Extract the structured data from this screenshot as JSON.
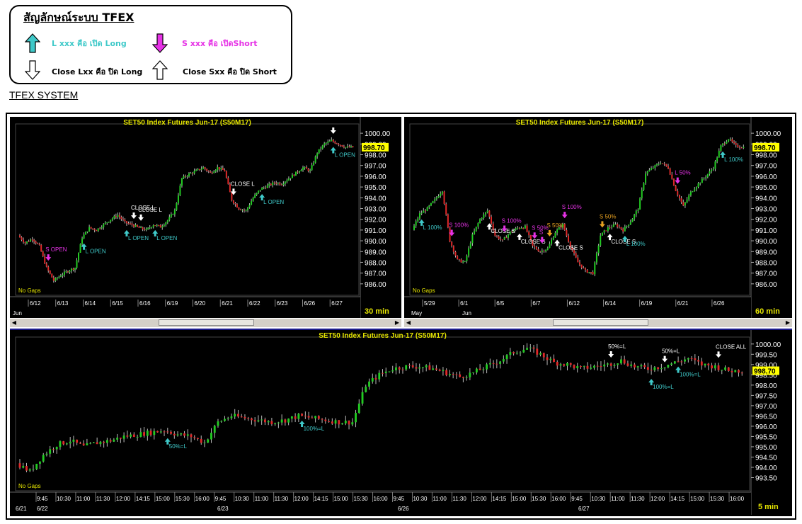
{
  "legend": {
    "title": "สัญลักษณ์ระบบ TFEX",
    "long_open": "L xxx คือ เปิด Long",
    "short_open": "S xxx คือ เปิดShort",
    "close_long": "Close Lxx คือ ปิด Long",
    "close_short": "Close Sxx คือ ปิด Short",
    "colors": {
      "long": "#3fc9c9",
      "short": "#e632e6"
    }
  },
  "system_label": "TFEX SYSTEM",
  "chart_data": [
    {
      "type": "candlestick",
      "title": "SET50  Index  Futures  Jun-17  (S50M17)",
      "timeframe": "30  min",
      "last_price": "998.70",
      "note": "No Gaps",
      "ylim": [
        985.2,
        1000.6
      ],
      "ticks": [
        "1000.00",
        "999.00",
        "998.00",
        "997.00",
        "996.00",
        "995.00",
        "994.00",
        "993.00",
        "992.00",
        "991.00",
        "990.00",
        "989.00",
        "988.00",
        "987.00",
        "986.00"
      ],
      "date_labels": [
        "6/12",
        "6/13",
        "6/14",
        "6/15",
        "6/16",
        "6/19",
        "6/20",
        "6/21",
        "6/22",
        "6/23",
        "6/26",
        "6/27"
      ],
      "bottom_label": "Jun",
      "path": [
        990.5,
        989.8,
        990.2,
        989.5,
        987.5,
        986.3,
        986.8,
        987.2,
        987.5,
        990.3,
        991.2,
        991.0,
        991.5,
        992.0,
        992.4,
        991.7,
        991.5,
        991.2,
        991.0,
        991.5,
        991.3,
        991.9,
        992.8,
        995.8,
        996.2,
        996.5,
        996.8,
        996.3,
        996.8,
        996.5,
        993.8,
        993.0,
        992.8,
        994.0,
        994.8,
        995.1,
        995.4,
        995.3,
        995.8,
        996.3,
        996.8,
        996.5,
        998.2,
        999.0,
        999.3,
        999.0,
        998.7,
        998.7
      ],
      "signals": [
        {
          "text": "S  OPEN",
          "kind": "short",
          "i": 4
        },
        {
          "text": "L  OPEN",
          "kind": "long",
          "i": 9
        },
        {
          "text": "L  OPEN",
          "kind": "long",
          "i": 15
        },
        {
          "text": "CLOSE  L",
          "kind": "closeL",
          "i": 16
        },
        {
          "text": "CLOSE  L",
          "kind": "closeL",
          "i": 17
        },
        {
          "text": "L  OPEN",
          "kind": "long",
          "i": 19
        },
        {
          "text": "CLOSE  L",
          "kind": "closeL",
          "i": 30
        },
        {
          "text": "L  OPEN",
          "kind": "long",
          "i": 34
        },
        {
          "text": "L  OPEN",
          "kind": "long",
          "i": 44
        },
        {
          "text": "",
          "kind": "closeL",
          "i": 44
        }
      ]
    },
    {
      "type": "candlestick",
      "title": "SET50  Index  Futures  Jun-17  (S50M17)",
      "timeframe": "60  min",
      "last_price": "998.70",
      "note": "No Gaps",
      "ylim": [
        985.2,
        1000.6
      ],
      "ticks": [
        "1000.00",
        "999.00",
        "998.00",
        "997.00",
        "996.00",
        "995.00",
        "994.00",
        "993.00",
        "992.00",
        "991.00",
        "990.00",
        "989.00",
        "988.00",
        "987.00",
        "986.00"
      ],
      "date_labels": [
        "5/29",
        "6/1",
        "6/5",
        "6/7",
        "6/12",
        "6/14",
        "6/19",
        "6/21",
        "6/26"
      ],
      "bottom_labels": [
        "May",
        "Jun"
      ],
      "path": [
        991.0,
        992.5,
        993.0,
        993.8,
        994.7,
        990.0,
        988.2,
        988.0,
        990.5,
        992.0,
        992.8,
        990.5,
        990.0,
        990.8,
        991.2,
        991.3,
        989.5,
        989.0,
        989.3,
        990.8,
        991.5,
        989.5,
        988.0,
        987.2,
        987.0,
        990.5,
        991.2,
        991.5,
        991.0,
        991.8,
        993.0,
        996.3,
        996.8,
        997.3,
        996.8,
        994.7,
        993.2,
        994.5,
        995.3,
        996.0,
        996.8,
        998.8,
        999.5,
        998.8,
        998.7
      ],
      "signals": [
        {
          "text": "L  100%",
          "kind": "long",
          "i": 1
        },
        {
          "text": "S  100%",
          "kind": "short",
          "i": 5
        },
        {
          "text": "CLOSE  S",
          "kind": "closeS",
          "i": 10
        },
        {
          "text": "S  100%",
          "kind": "short",
          "i": 12
        },
        {
          "text": "CLOSE  S",
          "kind": "closeS",
          "i": 14
        },
        {
          "text": "S  50%",
          "kind": "short",
          "i": 16
        },
        {
          "text": "S",
          "kind": "short",
          "i": 17
        },
        {
          "text": "S  50%",
          "kind": "shortY",
          "i": 18
        },
        {
          "text": "CLOSE  S",
          "kind": "closeS",
          "i": 19
        },
        {
          "text": "S  100%",
          "kind": "short",
          "i": 20
        },
        {
          "text": "S  50%",
          "kind": "shortY",
          "i": 25
        },
        {
          "text": "CLOSE  S",
          "kind": "closeS",
          "i": 26
        },
        {
          "text": "L  100%",
          "kind": "long",
          "i": 28
        },
        {
          "text": "L  50%",
          "kind": "short",
          "i": 35
        },
        {
          "text": "L  100%",
          "kind": "long",
          "i": 41
        }
      ]
    },
    {
      "type": "candlestick",
      "title": "SET50  Index  Futures  Jun-17  (S50M17)",
      "timeframe": "5  min",
      "last_price": "998.70",
      "note": "No Gaps",
      "ylim": [
        993.0,
        1000.2
      ],
      "ticks": [
        "1000.00",
        "999.50",
        "999.00",
        "998.50",
        "998.00",
        "997.50",
        "997.00",
        "996.50",
        "996.00",
        "995.50",
        "995.00",
        "994.50",
        "994.00",
        "993.50"
      ],
      "time_labels": [
        "9:45",
        "10:30",
        "11:00",
        "11:30",
        "12:00",
        "14:15",
        "15:00",
        "15:30",
        "16:00",
        "9:45",
        "10:30",
        "11:00",
        "11:30",
        "12:00",
        "14:15",
        "15:00",
        "15:30",
        "16:00",
        "9:45",
        "10:30",
        "11:00",
        "11:30",
        "12:00",
        "14:15",
        "15:00",
        "15:30",
        "16:00",
        "9:45",
        "10:30",
        "11:00",
        "11:30",
        "12:00",
        "14:15",
        "15:00",
        "15:30",
        "16:00"
      ],
      "date_labels": [
        "6/21",
        "6/22",
        "6/23",
        "6/26",
        "6/27"
      ],
      "path": [
        994.2,
        993.8,
        994.6,
        995.1,
        995.3,
        995.0,
        995.2,
        995.3,
        995.5,
        995.6,
        995.7,
        995.8,
        995.6,
        995.5,
        995.2,
        996.2,
        996.5,
        996.4,
        996.3,
        996.2,
        996.3,
        996.5,
        996.4,
        996.3,
        996.2,
        996.2,
        998.0,
        998.5,
        998.8,
        998.9,
        998.9,
        998.8,
        998.6,
        998.4,
        998.6,
        998.9,
        999.2,
        999.6,
        999.8,
        999.5,
        999.1,
        999.0,
        998.8,
        998.9,
        999.0,
        999.2,
        998.9,
        998.8,
        998.9,
        999.1,
        999.3,
        999.0,
        998.9,
        998.7,
        998.7
      ],
      "signals": [
        {
          "text": "50%=L",
          "kind": "long",
          "i": 11
        },
        {
          "text": "100%=L",
          "kind": "long",
          "i": 21
        },
        {
          "text": "50%=L",
          "kind": "closeL",
          "i": 44
        },
        {
          "text": "100%=L",
          "kind": "long",
          "i": 47
        },
        {
          "text": "50%=L",
          "kind": "closeL",
          "i": 48
        },
        {
          "text": "100%=L",
          "kind": "long",
          "i": 49
        },
        {
          "text": "CLOSE  ALL",
          "kind": "closeL",
          "i": 52
        }
      ]
    }
  ]
}
